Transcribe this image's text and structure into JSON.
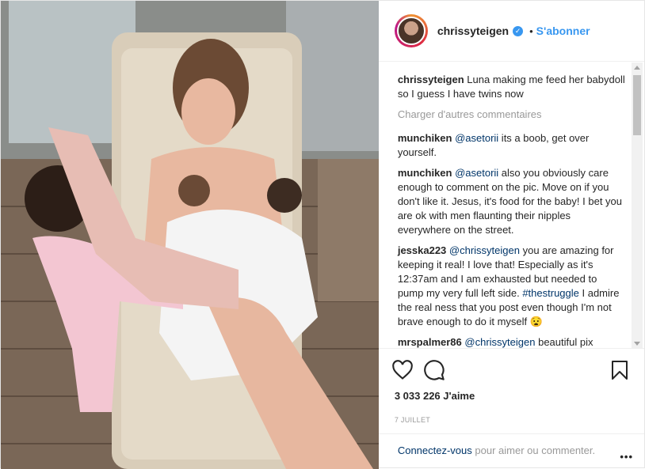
{
  "post": {
    "username": "chrissyteigen",
    "verified_mark": "✓",
    "separator": "•",
    "follow_label": "S'abonner",
    "caption": {
      "user": "chrissyteigen",
      "text": "Luna making me feed her babydoll so I guess I have twins now"
    },
    "load_more": "Charger d'autres commentaires",
    "comments": [
      {
        "user": "munchiken",
        "mention": "@asetorii",
        "text": " its a boob, get over yourself."
      },
      {
        "user": "munchiken",
        "mention": "@asetorii",
        "text": " also you obviously care enough to comment on the pic. Move on if you don't like it. Jesus, it's food for the baby! I bet you are ok with men flaunting their nipples everywhere on the street."
      },
      {
        "user": "jesska223",
        "mention": "@chrissyteigen",
        "text": " you are amazing for keeping it real! I love that! Especially as it's 12:37am and I am exhausted but needed to pump my very full left side. ",
        "hashtag": "#thestruggle",
        "text2": " I admire the real ness that you post even though I'm not brave enough to do it myself 😧"
      },
      {
        "user": "mrspalmer86",
        "mention": "@chrissyteigen",
        "text": " beautiful pix"
      }
    ],
    "likes": "3 033 226 J'aime",
    "date": "7 JUILLET",
    "login_link": "Connectez-vous",
    "login_text": " pour aimer ou commenter.",
    "more_label": "•••"
  },
  "icons": {
    "like": "heart-icon",
    "comment": "comment-icon",
    "save": "bookmark-icon",
    "verified": "verified-badge-icon"
  },
  "colors": {
    "link_blue": "#3897f0",
    "mention_blue": "#003569",
    "muted": "#999999"
  }
}
